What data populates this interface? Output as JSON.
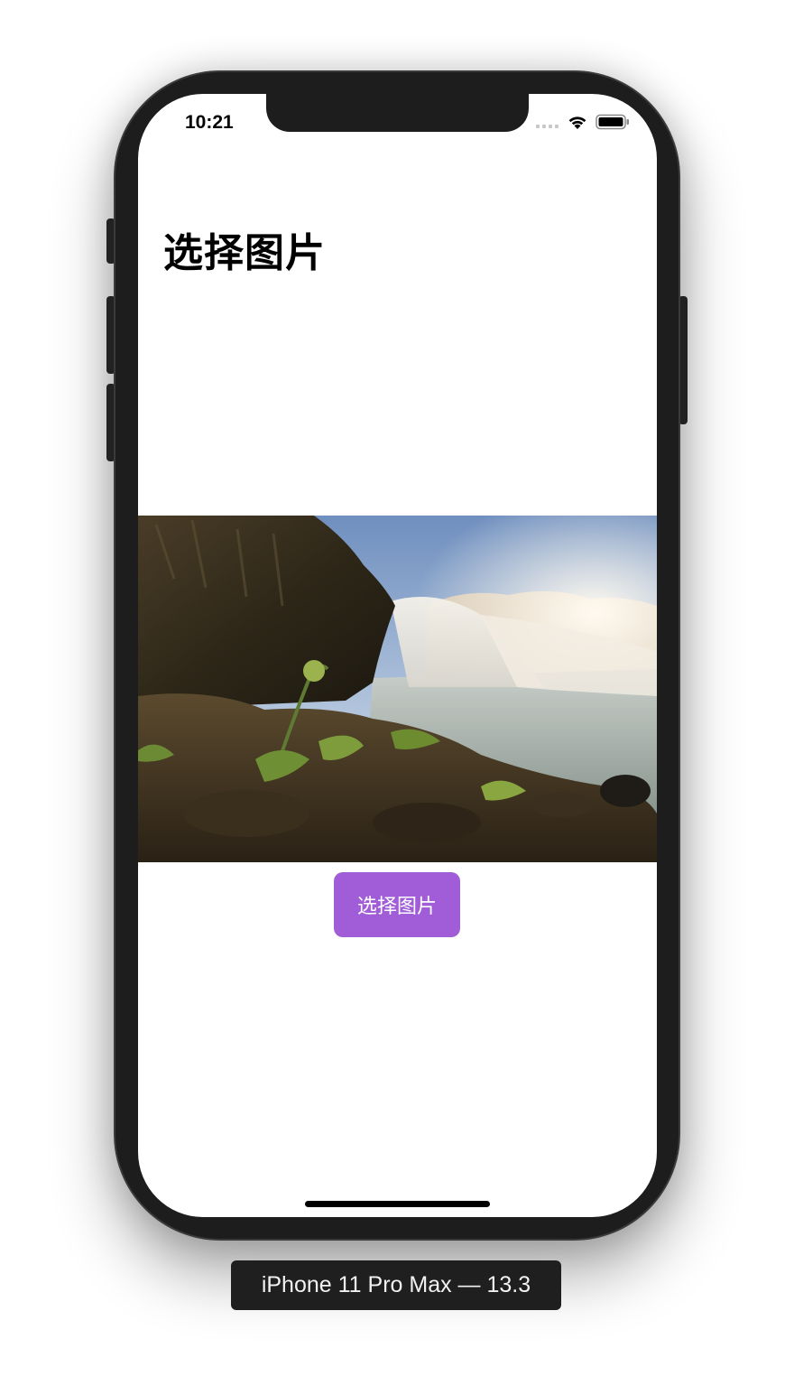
{
  "status_bar": {
    "time": "10:21",
    "icons": [
      "cellular-signal-icon",
      "wifi-icon",
      "battery-icon"
    ]
  },
  "page": {
    "title": "选择图片"
  },
  "photo": {
    "subject": "waterfall-image"
  },
  "pick_button": {
    "label": "选择图片",
    "color": "#a05dd7"
  },
  "simulator": {
    "device_label": "iPhone 11 Pro Max — 13.3"
  }
}
